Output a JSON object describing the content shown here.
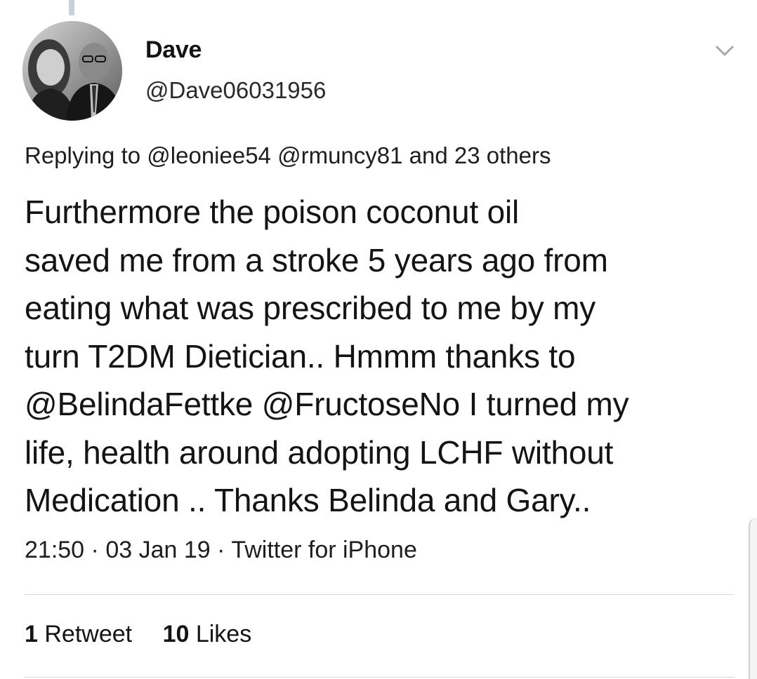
{
  "tweet": {
    "author": {
      "display_name": "Dave",
      "handle": "@Dave06031956",
      "avatar": "profile-photo"
    },
    "reply_context": {
      "prefix": "Replying to",
      "mention_1": "@leoniee54",
      "mention_2": "@rmuncy81",
      "suffix": "and 23 others"
    },
    "text": "Furthermore the poison coconut oil\nsaved me from a stroke 5 years ago from\neating what was prescribed to me by my\nturn T2DM Dietician.. Hmmm thanks to\n@BelindaFettke @FructoseNo I turned my\nlife, health around adopting LCHF without\nMedication .. Thanks Belinda and Gary..",
    "time": "21:50",
    "date": "03 Jan 19",
    "source": "Twitter for iPhone",
    "separator": "·",
    "stats": {
      "retweets_count": "1",
      "retweets_label": "Retweet",
      "likes_count": "10",
      "likes_label": "Likes"
    },
    "menu_icon": "chevron-down-icon"
  },
  "colors": {
    "text": "#141414",
    "secondary_text": "#2a2a2a",
    "divider": "#dadada",
    "thread_line": "#c9d0d6"
  }
}
